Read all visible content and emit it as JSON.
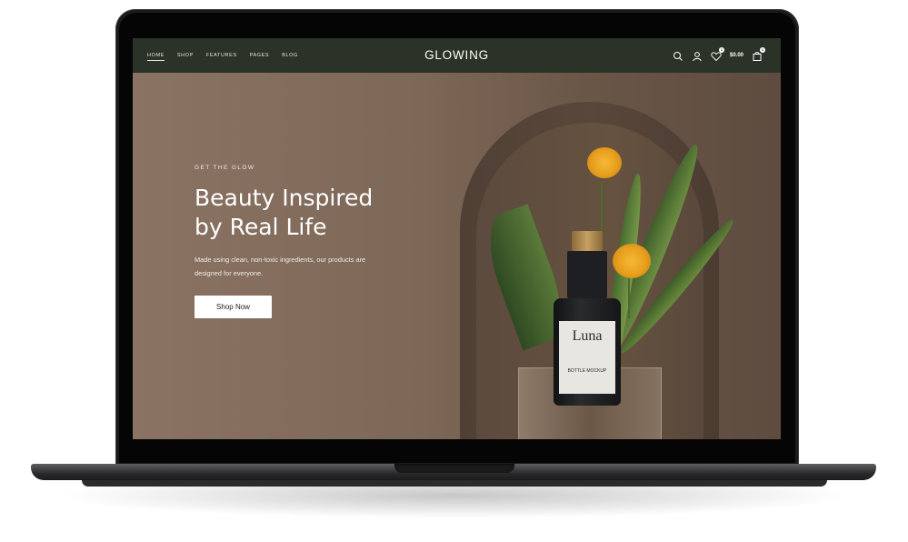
{
  "header": {
    "brand": "GLOWING",
    "nav": [
      "HOME",
      "SHOP",
      "FEATURES",
      "PAGES",
      "BLOG"
    ],
    "active_nav": "HOME",
    "cart_total": "$0.00",
    "wishlist_count": "1",
    "cart_count": "1",
    "icons": [
      "search-icon",
      "user-icon",
      "wishlist-icon",
      "cart-icon"
    ]
  },
  "hero": {
    "eyebrow": "GET THE GLOW",
    "headline_line1": "Beauty Inspired",
    "headline_line2": "by Real Life",
    "description": "Made using clean, non-toxic ingredients, our products are designed for everyone.",
    "cta_label": "Shop Now",
    "product_label": "Luna",
    "product_sublabel": "BOTTLE MOCKUP"
  },
  "colors": {
    "nav_bg": "#2b3328",
    "hero_bg": "#7d6757",
    "button_bg": "#ffffff",
    "text_light": "#ffffff"
  }
}
